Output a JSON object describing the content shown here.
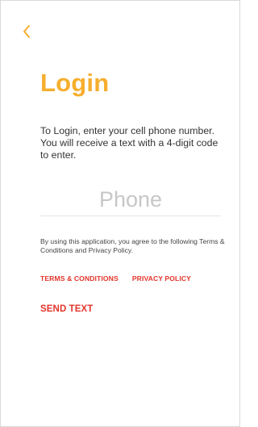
{
  "header": {
    "back_icon": "chevron-left-icon"
  },
  "login": {
    "title": "Login",
    "instructions": "To Login, enter your cell phone number. You will receive a text with a 4-digit code to enter.",
    "phone_placeholder": "Phone",
    "phone_value": "",
    "agreement": "By using this application, you agree to the following Terms & Conditions and Privacy Policy.",
    "terms_label": "TERMS & CONDITIONS",
    "privacy_label": "PRIVACY POLICY",
    "send_label": "SEND TEXT"
  },
  "colors": {
    "accent": "#f6ae2d",
    "link": "#e4342b",
    "text": "#333333"
  }
}
